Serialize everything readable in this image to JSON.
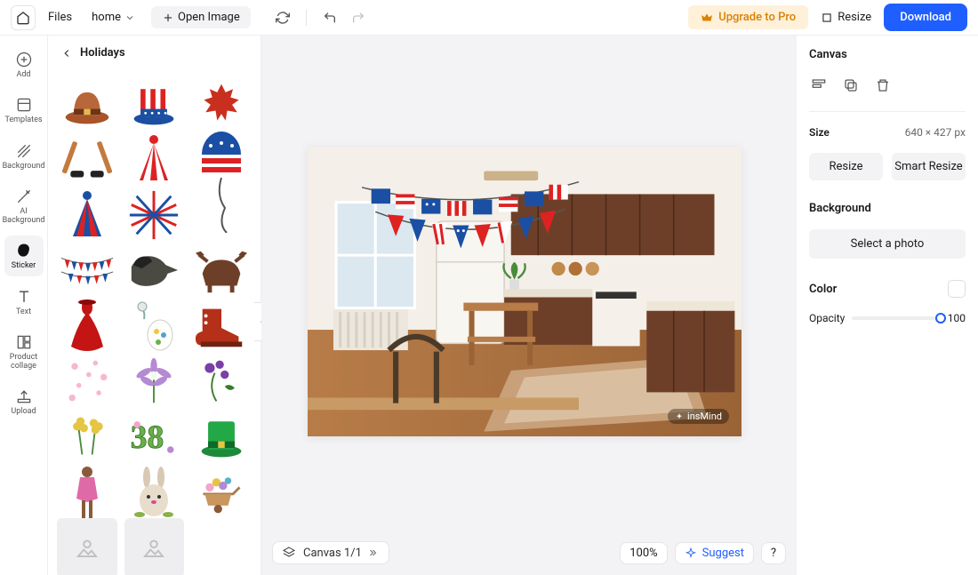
{
  "topbar": {
    "files": "Files",
    "home": "home",
    "open_image": "Open Image",
    "upgrade": "Upgrade to Pro",
    "resize": "Resize",
    "download": "Download"
  },
  "leftnav": [
    {
      "id": "add",
      "label": "Add",
      "icon": "plus-circle-icon"
    },
    {
      "id": "templates",
      "label": "Templates",
      "icon": "templates-icon"
    },
    {
      "id": "background",
      "label": "Background",
      "icon": "diagonal-lines-icon"
    },
    {
      "id": "ai-background",
      "label": "AI\nBackground",
      "icon": "ai-bg-icon"
    },
    {
      "id": "sticker",
      "label": "Sticker",
      "icon": "blob-icon",
      "active": true
    },
    {
      "id": "text",
      "label": "Text",
      "icon": "text-icon"
    },
    {
      "id": "product-collage",
      "label": "Product\ncollage",
      "icon": "collage-icon"
    },
    {
      "id": "upload",
      "label": "Upload",
      "icon": "upload-icon"
    }
  ],
  "sticker_panel": {
    "title": "Holidays",
    "items": [
      {
        "id": "pilgrim-hat"
      },
      {
        "id": "uncle-sam-hat"
      },
      {
        "id": "maple-leaf"
      },
      {
        "id": "hockey-sticks"
      },
      {
        "id": "party-hat-red"
      },
      {
        "id": "party-hat-blue"
      },
      {
        "id": "balloon-usa"
      },
      {
        "id": "firework-red-blue"
      },
      {
        "id": "bunting-flags"
      },
      {
        "id": "goose"
      },
      {
        "id": "moose"
      },
      {
        "id": "red-dress"
      },
      {
        "id": "easter-egg"
      },
      {
        "id": "red-boot"
      },
      {
        "id": "pink-petals"
      },
      {
        "id": "purple-flower"
      },
      {
        "id": "violet-flowers"
      },
      {
        "id": "yellow-flowers"
      },
      {
        "id": "number-38"
      },
      {
        "id": "green-top-hat"
      },
      {
        "id": "person-pink"
      },
      {
        "id": "bunny"
      },
      {
        "id": "flower-cart"
      },
      {
        "id": "loading-1",
        "loading": true
      },
      {
        "id": "loading-2",
        "loading": true
      }
    ]
  },
  "canvas": {
    "size_label": "640 × 427 px",
    "watermark": "insMind",
    "bottom_label": "Canvas 1/1",
    "zoom": "100%",
    "suggest": "Suggest",
    "help": "?"
  },
  "rightpanel": {
    "title": "Canvas",
    "size_label": "Size",
    "resize": "Resize",
    "smart_resize": "Smart Resize",
    "background_label": "Background",
    "select_photo": "Select a photo",
    "color_label": "Color",
    "opacity_label": "Opacity",
    "opacity_value": "100"
  }
}
